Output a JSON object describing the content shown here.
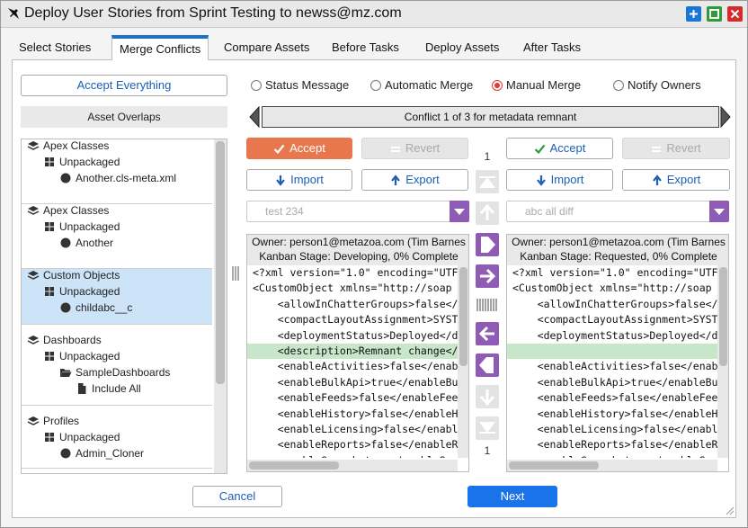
{
  "window": {
    "title": "Deploy User Stories from Sprint Testing to newss@mz.com",
    "icon": "pin-icon",
    "colors": {
      "window_btn_1": "#1976d2",
      "window_btn_2": "#2e9b3a",
      "window_btn_3": "#d52b2b"
    }
  },
  "tabs": [
    {
      "label": "Select Stories",
      "active": false
    },
    {
      "label": "Merge Conflicts",
      "active": true
    },
    {
      "label": "Compare Assets",
      "active": false
    },
    {
      "label": "Before Tasks",
      "active": false
    },
    {
      "label": "Deploy Assets",
      "active": false
    },
    {
      "label": "After Tasks",
      "active": false
    }
  ],
  "left": {
    "accept_everything": "Accept Everything",
    "asset_overlaps": "Asset Overlaps",
    "groups": [
      {
        "type": "Apex Classes",
        "package": "Unpackaged",
        "items": [
          "Another.cls-meta.xml"
        ]
      },
      {
        "type": "Apex Classes",
        "package": "Unpackaged",
        "items": [
          "Another"
        ]
      },
      {
        "type": "Custom Objects",
        "package": "Unpackaged",
        "items": [
          "childabc__c"
        ],
        "selected": true
      },
      {
        "type": "Dashboards",
        "package": "Unpackaged",
        "folder": "SampleDashboards",
        "items": [
          "Include All"
        ]
      },
      {
        "type": "Profiles",
        "package": "Unpackaged",
        "items": [
          "Admin_Cloner"
        ]
      }
    ]
  },
  "modes": {
    "options": [
      "Status Message",
      "Automatic Merge",
      "Manual Merge",
      "Notify Owners"
    ],
    "selected": "Manual Merge",
    "accent": "#e53935"
  },
  "conflict": {
    "text": "Conflict 1 of 3 for metadata remnant"
  },
  "left_pane": {
    "accept": "Accept",
    "revert": "Revert",
    "import": "Import",
    "export": "Export",
    "select_value": "test 234",
    "header_line1": "Owner: person1@metazoa.com (Tim Barnes",
    "header_line2": "Kanban Stage: Developing, 0% Complete",
    "lines": [
      "<?xml version=\"1.0\" encoding=\"UTF",
      "<CustomObject xmlns=\"http://soap",
      "    <allowInChatterGroups>false</",
      "    <compactLayoutAssignment>SYST",
      "    <deploymentStatus>Deployed</d",
      "    <description>Remnant change</",
      "    <enableActivities>false</enab",
      "    <enableBulkApi>true</enableBu",
      "    <enableFeeds>false</enableFee",
      "    <enableHistory>false</enableH",
      "    <enableLicensing>false</enabl",
      "    <enableReports>false</enableR",
      "    <enableSearch>true</enableSea"
    ],
    "highlight_index": 5
  },
  "right_pane": {
    "accept": "Accept",
    "revert": "Revert",
    "import": "Import",
    "export": "Export",
    "select_value": "abc all diff",
    "header_line1": "Owner: person1@metazoa.com (Tim Barnes",
    "header_line2": "Kanban Stage: Requested, 0% Complete",
    "lines": [
      "<?xml version=\"1.0\" encoding=\"UTF",
      "<CustomObject xmlns=\"http://soap",
      "    <allowInChatterGroups>false</",
      "    <compactLayoutAssignment>SYST",
      "    <deploymentStatus>Deployed</d",
      "",
      "    <enableActivities>false</enab",
      "    <enableBulkApi>true</enableBu",
      "    <enableFeeds>false</enableFee",
      "    <enableHistory>false</enableH",
      "    <enableLicensing>false</enabl",
      "    <enableReports>false</enableR",
      "    <enableSearch>true</enableSea"
    ],
    "highlight_index": 5
  },
  "middle": {
    "top_count": "1",
    "bottom_count": "1",
    "accent": "#8e5bb5"
  },
  "footer": {
    "cancel": "Cancel",
    "next": "Next"
  }
}
